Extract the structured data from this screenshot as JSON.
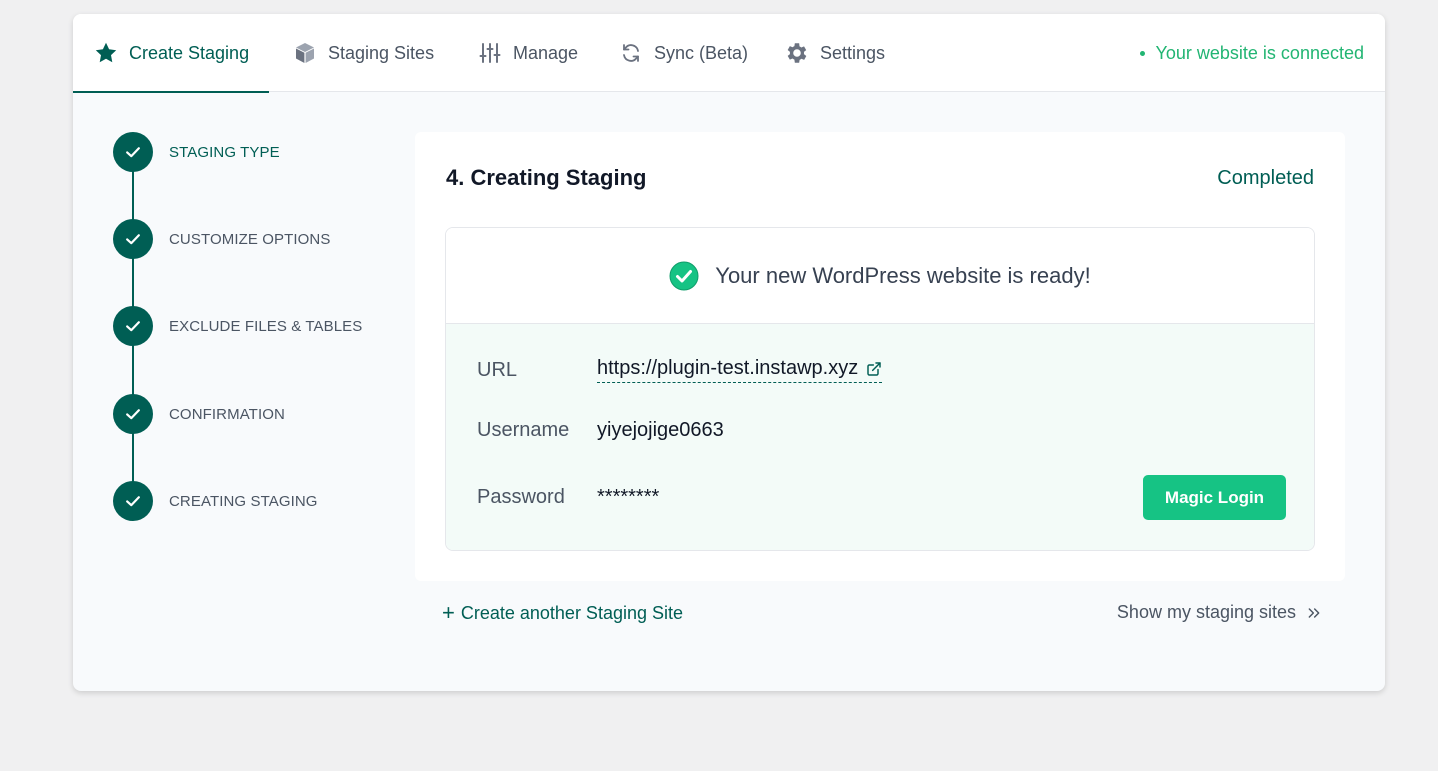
{
  "tabs": [
    {
      "label": "Create Staging",
      "icon": "star-icon",
      "active": true
    },
    {
      "label": "Staging Sites",
      "icon": "box-icon"
    },
    {
      "label": "Manage",
      "icon": "sliders-icon"
    },
    {
      "label": "Sync (Beta)",
      "icon": "sync-icon"
    },
    {
      "label": "Settings",
      "icon": "gear-icon"
    }
  ],
  "connection_status": "Your website is connected",
  "steps": [
    {
      "label": "STAGING TYPE"
    },
    {
      "label": "CUSTOMIZE OPTIONS"
    },
    {
      "label": "EXCLUDE FILES & TABLES"
    },
    {
      "label": "CONFIRMATION"
    },
    {
      "label": "CREATING STAGING"
    }
  ],
  "panel": {
    "title": "4. Creating Staging",
    "status": "Completed",
    "ready_message": "Your new WordPress website is ready!",
    "url_label": "URL",
    "url_value": "https://plugin-test.instawp.xyz",
    "username_label": "Username",
    "username_value": "yiyejojige0663",
    "password_label": "Password",
    "password_value": "********",
    "magic_login_label": "Magic Login"
  },
  "footer": {
    "create_another": "Create another Staging Site",
    "show_sites": "Show my staging sites"
  },
  "colors": {
    "brand": "#005e54",
    "accent": "#16c384",
    "connected": "#22b573"
  }
}
